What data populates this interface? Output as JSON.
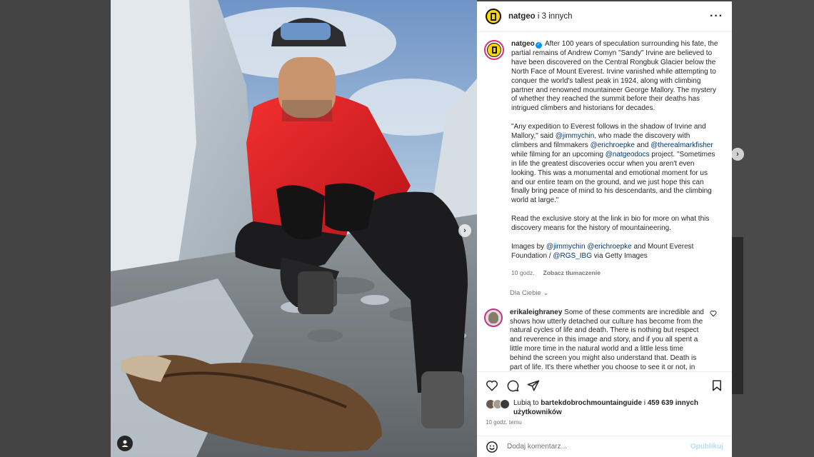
{
  "colors": {
    "accent": "#0095f6",
    "panel_bg": "#ffffff",
    "backdrop": "#474747",
    "brand_yellow": "#fbd600"
  },
  "photo": {
    "user_tag_icon": "user-tag-icon",
    "next_icon": "chevron-right-icon"
  },
  "header": {
    "username": "natgeo",
    "coauthors": " i 3 innych",
    "more_icon": "more-dots-icon"
  },
  "caption": {
    "username": "natgeo",
    "paragraphs": [
      "After 100 years of speculation surrounding his fate, the partial remains of Andrew Comyn \"Sandy\" Irvine are believed to have been discovered on the Central Rongbuk Glacier below the North Face of Mount Everest. Irvine vanished while attempting to conquer the world's tallest peak in 1924, along with climbing partner and renowned mountaineer George Mallory. The mystery of whether they reached the summit before their deaths has intrigued climbers and historians for decades."
    ],
    "quote_a": "\"Any expedition to Everest follows in the shadow of Irvine and Mallory,\" said ",
    "mention_jimmy": "@jimmychin",
    "quote_b": ", who made the discovery with climbers and filmmakers ",
    "mention_eric": "@erichroepke",
    "quote_c": " and ",
    "mention_mark": "@therealmarkfisher",
    "quote_d": " while filming for an upcoming ",
    "mention_docs": "@natgeodocs",
    "quote_e": " project. \"Sometimes in life the greatest discoveries occur when you aren't even looking. This was a monumental and emotional moment for us and our entire team on the ground, and we just hope this can finally bring peace of mind to his descendants, and the climbing world at large.\"",
    "read_more": "Read the exclusive story at the link in bio for more on what this discovery means for the history of mountaineering.",
    "credits_a": "Images by ",
    "credits_mention1": "@jimmychin",
    "credits_mention2": "@erichroepke",
    "credits_b": " and Mount Everest Foundation / ",
    "credits_mention3": "@RGS_IBG",
    "credits_c": " via Getty Images",
    "time": "10 godz.",
    "translate": "Zobacz tłumaczenie"
  },
  "for_you": "Dla Ciebie",
  "comment": {
    "username": "erikaleighraney",
    "text": "Some of these comments are incredible and shows how utterly detached our culture has become from the natural cycles of life and death. There is nothing but respect and reverence in this image and story, and if you all spent a little more time in the natural world and a little less time behind the screen you might also understand that. Death is part of life. It's there whether you choose to see it or not, in the food you eat and the passing of our loved ones and ancestors."
  },
  "actions": {
    "like_icon": "heart-icon",
    "comment_icon": "comment-icon",
    "share_icon": "share-icon",
    "save_icon": "bookmark-icon"
  },
  "likes": {
    "prefix": "Lubią to ",
    "user": "bartekdobrochmountainguide",
    "suffix_a": " i ",
    "count": "459 639 innych użytkowników"
  },
  "time_ago": "10 godz. temu",
  "comment_input": {
    "placeholder": "Dodaj komentarz...",
    "post_label": "Opublikuj"
  }
}
